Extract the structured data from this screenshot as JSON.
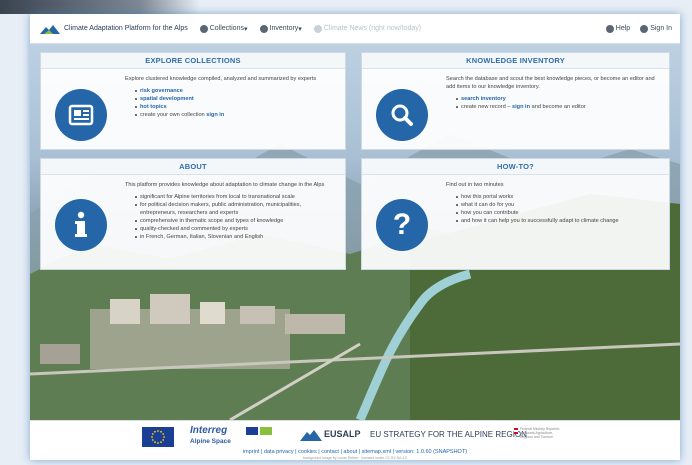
{
  "nav": {
    "brand": "Climate Adaptation Platform for the Alps",
    "collections": "Collections",
    "inventory": "Inventory",
    "dim_item": "Climate News (right now/today)",
    "help": "Help",
    "signin": "Sign In"
  },
  "explore": {
    "title": "EXPLORE COLLECTIONS",
    "intro": "Explore clustered knowledge compiled, analyzed and summarized by experts",
    "items": [
      "risk governance",
      "spatial development",
      "hot topics"
    ],
    "create_prefix": "create your own collection",
    "create_link": "sign in"
  },
  "knowledge": {
    "title": "KNOWLEDGE INVENTORY",
    "intro": "Search the database and scout the best knowledge pieces, or become an editor and add items to our knowledge inventory.",
    "search_link": "search inventory",
    "new_prefix": "create new record –",
    "new_link": "sign in",
    "new_suffix": "and become an editor"
  },
  "about": {
    "title": "ABOUT",
    "intro": "This platform provides knowledge about adaptation to climate change in the Alps",
    "items": [
      "significant for Alpine territories from local to transnational scale",
      "for political decision makers, public administration, municipalities, entrepreneurs, researchers and experts",
      "comprehensive in thematic scope and types of knowledge",
      "quality-checked and commented by experts",
      "in French, German, Italian, Slovenian and English"
    ]
  },
  "howto": {
    "title": "HOW-TO?",
    "intro": "Find out in two minutes",
    "items": [
      "how this portal works",
      "what it can do for you",
      "how you can contribute",
      "and how it can help you to successfully adapt to climate change"
    ]
  },
  "footer": {
    "interreg": "Interreg",
    "alpine_space": "Alpine Space",
    "eusalp": "EUSALP",
    "eusalp_sub": "EU STRATEGY FOR THE ALPINE REGION",
    "austria": "Federal Ministry Republic of Austria Agriculture, Regions and Tourism",
    "links": "imprint | data privacy | cookies | contact | about | sitemap.xml | version: 1.0.60 (SNAPSHOT)",
    "meta": "background image by Lucas Ruther · licensed under CC BY-SA 4.0"
  },
  "colors": {
    "accent": "#2466a8",
    "title": "#2f6ea8"
  },
  "icons": [
    "alps-logo-icon",
    "collections-icon",
    "search-icon",
    "info-icon",
    "help-icon",
    "signin-icon",
    "newspaper-icon",
    "question-icon"
  ]
}
